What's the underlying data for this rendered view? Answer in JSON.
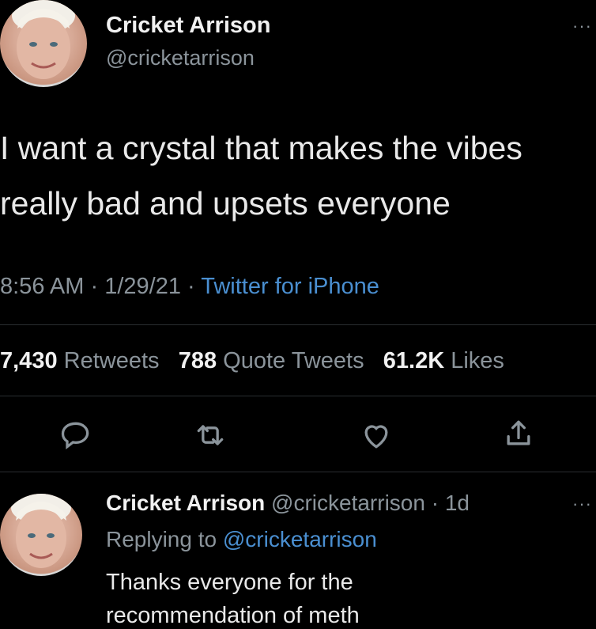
{
  "tweet": {
    "name": "Cricket Arrison",
    "handle": "@cricketarrison",
    "text_line1": "I want a crystal that makes the vibes",
    "text_line2": "really bad and upsets everyone",
    "time": "8:56 AM",
    "date": "1/29/21",
    "source": "Twitter for iPhone",
    "sep": "·",
    "more": "···"
  },
  "stats": {
    "retweets_count": "7,430",
    "retweets_label": "Retweets",
    "quotes_count": "788",
    "quotes_label": "Quote Tweets",
    "likes_count": "61.2K",
    "likes_label": "Likes"
  },
  "reply": {
    "name": "Cricket Arrison",
    "handle": "@cricketarrison",
    "age": "1d",
    "replying_prefix": "Replying to",
    "replying_to": "@cricketarrison",
    "text_line1": "Thanks everyone for the",
    "text_line2": "recommendation of meth"
  }
}
